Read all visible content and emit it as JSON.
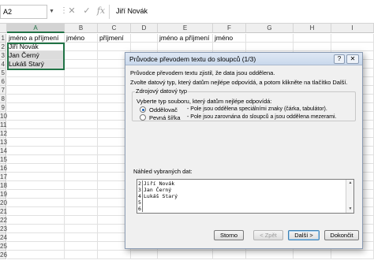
{
  "formula_bar": {
    "name_box": "A2",
    "cancel_glyph": "✕",
    "enter_glyph": "✓",
    "fx_label": "fx",
    "content": "Jiří Novák"
  },
  "sheet": {
    "columns": [
      "A",
      "B",
      "C",
      "D",
      "E",
      "F",
      "G",
      "H",
      "I"
    ],
    "selected_column": "A",
    "rows": [
      [
        "jméno a příjmení",
        "jméno",
        "příjmení",
        "",
        "jméno a příjmení",
        "jméno",
        "",
        "",
        ""
      ],
      [
        "Jiří Novák",
        "",
        "",
        "",
        "",
        "",
        "",
        "",
        ""
      ],
      [
        "Jan Černý",
        "",
        "",
        "",
        "",
        "",
        "",
        "",
        ""
      ],
      [
        "Lukáš Starý",
        "",
        "",
        "",
        "",
        "",
        "",
        "",
        ""
      ]
    ],
    "selection": "A2:A4",
    "active_cell": "A2"
  },
  "dialog": {
    "title": "Průvodce převodem textu do sloupců (1/3)",
    "help_label": "?",
    "close_label": "✕",
    "intro": "Průvodce převodem textu zjistil, že data jsou oddělena.",
    "instruction": "Zvolte datový typ, který datům nejlépe odpovídá, a potom klikněte na tlačítko Další.",
    "source_group_label": "Zdrojový datový typ",
    "source_prompt": "Vyberte typ souboru, který datům nejlépe odpovídá:",
    "options": [
      {
        "label": "Oddělovač",
        "description": "- Pole jsou oddělena speciálními znaky (čárka, tabulátor).",
        "selected": true
      },
      {
        "label": "Pevná šířka",
        "description": "- Pole jsou zarovnána do sloupců a jsou oddělena mezerami.",
        "selected": false
      }
    ],
    "preview_label": "Náhled vybraných dat:",
    "preview_lines": [
      {
        "num": "2",
        "text": "Jiří Novák"
      },
      {
        "num": "3",
        "text": "Jan Černý"
      },
      {
        "num": "4",
        "text": "Lukáš Starý"
      },
      {
        "num": "5",
        "text": ""
      },
      {
        "num": "6",
        "text": ""
      }
    ],
    "buttons": {
      "cancel": "Storno",
      "back": "< Zpět",
      "next": "Další >",
      "finish": "Dokončit"
    }
  }
}
